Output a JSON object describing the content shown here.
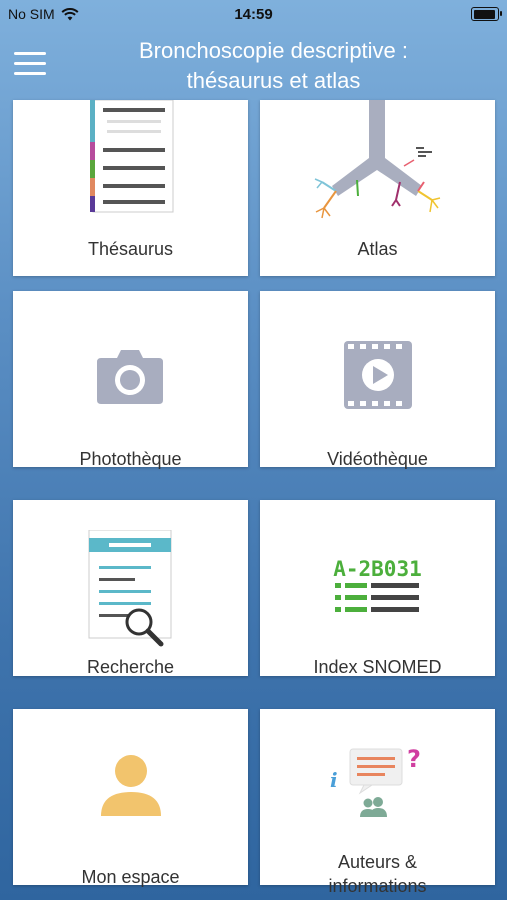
{
  "status": {
    "carrier": "No SIM",
    "time": "14:59"
  },
  "header": {
    "title_line1": "Bronchoscopie descriptive :",
    "title_line2": "thésaurus et atlas"
  },
  "tiles": [
    {
      "label": "Thésaurus"
    },
    {
      "label": "Atlas"
    },
    {
      "label": "Photothèque"
    },
    {
      "label": "Vidéothèque"
    },
    {
      "label": "Recherche"
    },
    {
      "label": "Index SNOMED"
    },
    {
      "label": "Mon espace"
    },
    {
      "label_line1": "Auteurs &",
      "label_line2": "informations"
    }
  ],
  "snomed_icon_code": "A-2B031",
  "colors": {
    "accent_green": "#4caf3c",
    "icon_gray": "#a8adbf",
    "user_yellow": "#f2c46d"
  }
}
